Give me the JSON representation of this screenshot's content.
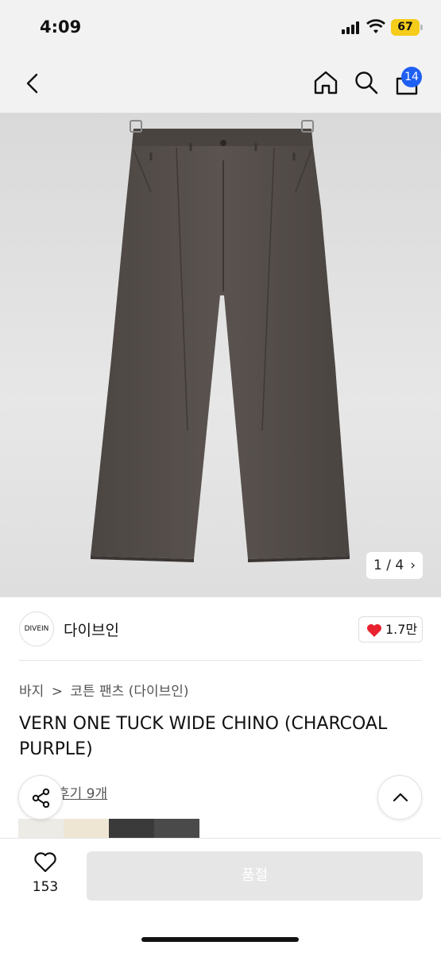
{
  "status_bar": {
    "time": "4:09",
    "battery": "67"
  },
  "nav": {
    "cart_count": "14"
  },
  "gallery": {
    "counter": "1 / 4",
    "counter_chevron": "›"
  },
  "brand": {
    "logo_text": "DIVEIN",
    "name": "다이브인",
    "likes": "1.7만"
  },
  "breadcrumb": {
    "category": "바지",
    "separator": ">",
    "subcategory": "코튼 팬츠 (다이브인)"
  },
  "product": {
    "title": "VERN ONE TUCK WIDE CHINO (CHARCOAL PURPLE)",
    "reviews": "후기 9개"
  },
  "swatch_colors": [
    "#ecebe6",
    "#eee6d2",
    "#3a3a3a",
    "#4a4a4a"
  ],
  "bottom_bar": {
    "wish_count": "153",
    "soldout_label": "품절"
  },
  "colors": {
    "accent": "#1f5ff2",
    "heart": "#e8232f",
    "battery": "#f5cc1a"
  }
}
